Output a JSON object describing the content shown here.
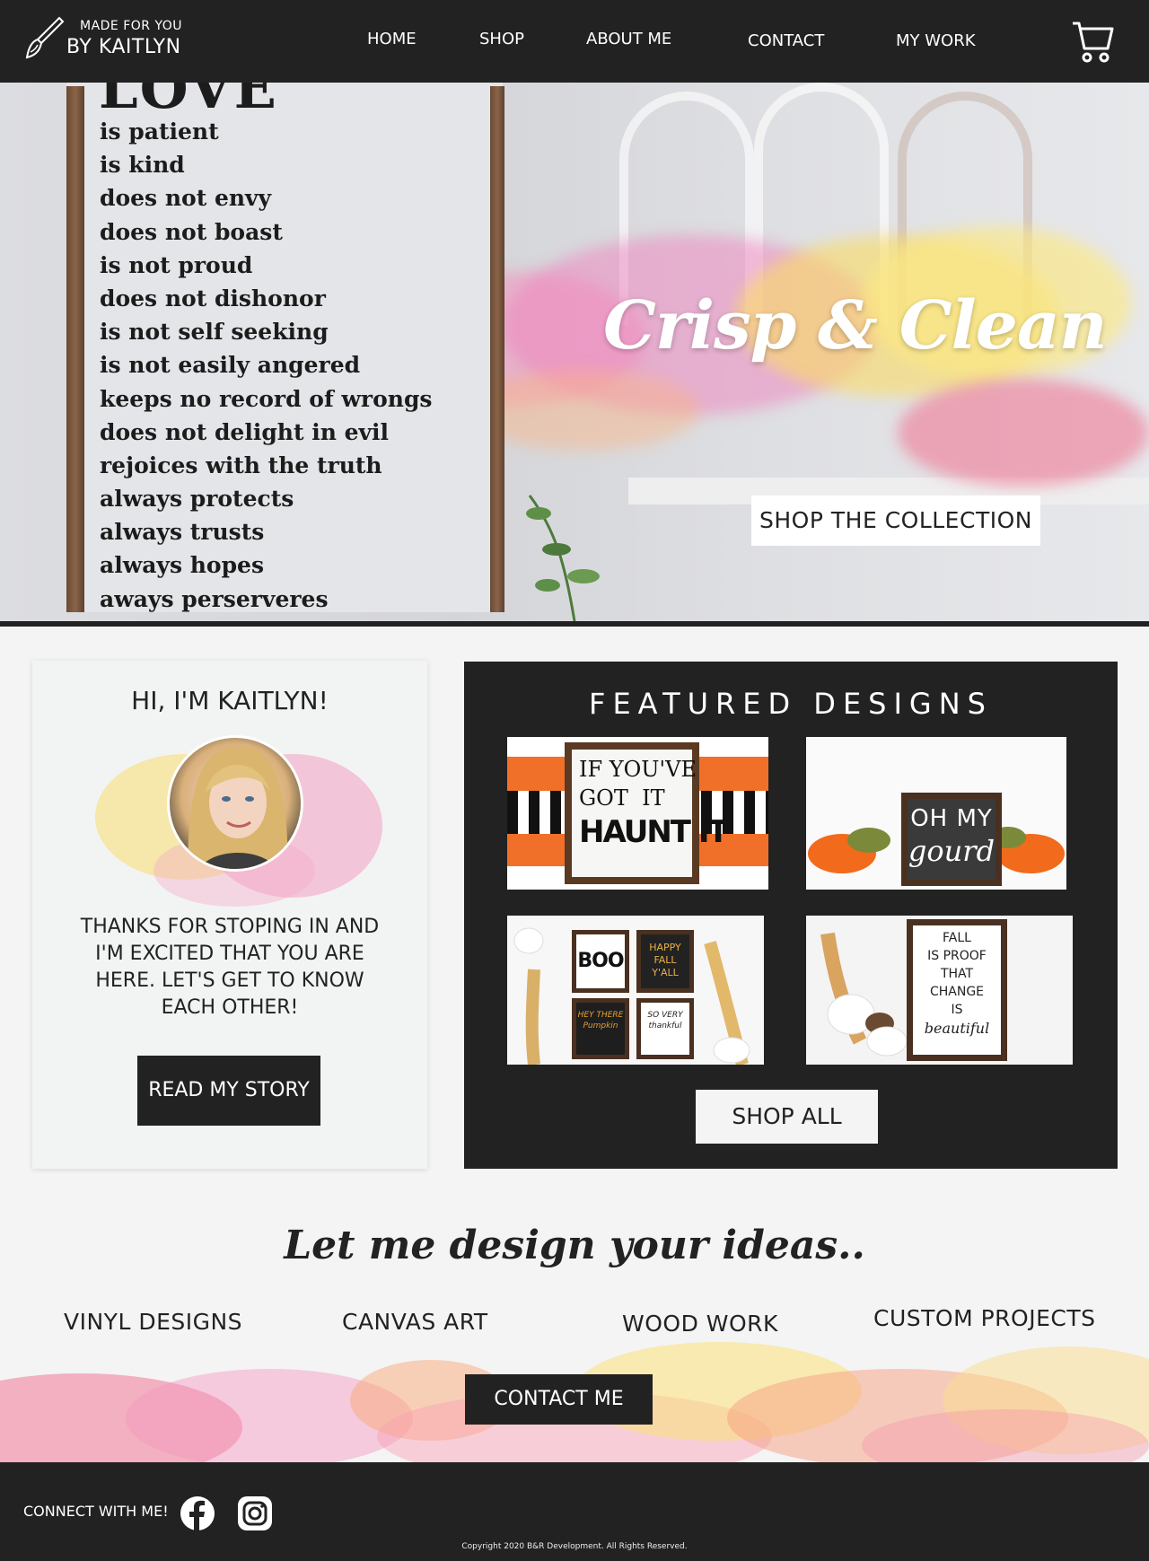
{
  "header": {
    "logo_line1": "MADE FOR YOU",
    "logo_line2": "BY KAITLYN",
    "nav": [
      {
        "label": "HOME"
      },
      {
        "label": "SHOP"
      },
      {
        "label": "ABOUT ME"
      },
      {
        "label": "CONTACT"
      },
      {
        "label": "MY WORK"
      }
    ],
    "cart_icon": "shopping-cart-icon"
  },
  "hero": {
    "title": "Crisp & Clean",
    "button_label": "SHOP THE COLLECTION",
    "sign_title": "LOVE",
    "sign_lines": [
      "is patient",
      "is kind",
      "does not envy",
      "does not boast",
      "is not proud",
      "does not dishonor",
      "is not self seeking",
      "is not easily angered",
      "keeps no record of wrongs",
      "does not delight in evil",
      "rejoices with the truth",
      "always protects",
      "always trusts",
      "always hopes",
      "aways perserveres"
    ]
  },
  "about": {
    "title": "HI, I'M KAITLYN!",
    "text": "THANKS FOR STOPING IN AND I'M EXCITED THAT YOU ARE HERE. LET'S GET TO KNOW EACH OTHER!",
    "button_label": "READ MY STORY"
  },
  "featured": {
    "title": "FEATURED DESIGNS",
    "items": [
      {
        "sign_lines": [
          "IF YOU'VE",
          "GOT  IT",
          "HAUNT IT"
        ]
      },
      {
        "sign_lines": [
          "OH MY",
          "gourd"
        ]
      },
      {
        "sign_lines": [
          "BOO",
          "HAPPY FALL Y'ALL",
          "HEY THERE Pumpkin",
          "SO VERY thankful"
        ]
      },
      {
        "sign_lines": [
          "FALL",
          "IS PROOF",
          "THAT",
          "CHANGE",
          "IS",
          "beautiful"
        ]
      }
    ],
    "button_label": "SHOP ALL"
  },
  "design": {
    "heading": "Let me design your ideas..",
    "services": [
      "VINYL DESIGNS",
      "CANVAS ART",
      "WOOD WORK",
      "CUSTOM PROJECTS"
    ],
    "button_label": "CONTACT ME"
  },
  "footer": {
    "connect_label": "CONNECT WITH ME!",
    "social": [
      {
        "icon": "facebook-icon"
      },
      {
        "icon": "instagram-icon"
      }
    ],
    "copyright": "Copyright 2020 B&R Development. All Rights Reserved."
  },
  "colors": {
    "dark": "#222222",
    "light": "#f4f4f4",
    "accent_pink": "#f28ca8",
    "accent_yellow": "#f7d96a",
    "accent_orange": "#f5a46e"
  }
}
